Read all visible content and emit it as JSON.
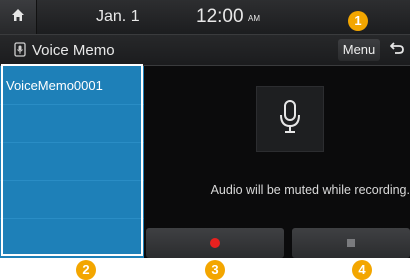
{
  "statusbar": {
    "home_icon": "home-icon",
    "date": "Jan.  1",
    "time": "12:00",
    "ampm": "AM"
  },
  "titlebar": {
    "app_icon": "voice-memo-icon",
    "title": "Voice Memo",
    "menu_label": "Menu",
    "back_icon": "back-arrow-icon"
  },
  "recordings": [
    {
      "label": "VoiceMemo0001"
    }
  ],
  "main": {
    "mic_icon": "microphone-icon",
    "notice": "Audio will be muted while recording.",
    "record_icon": "record-icon",
    "stop_icon": "stop-icon"
  },
  "callouts": [
    "1",
    "2",
    "3",
    "4"
  ],
  "colors": {
    "accent": "#1e80b8",
    "record": "#e8211f",
    "callout": "#f3a600"
  }
}
